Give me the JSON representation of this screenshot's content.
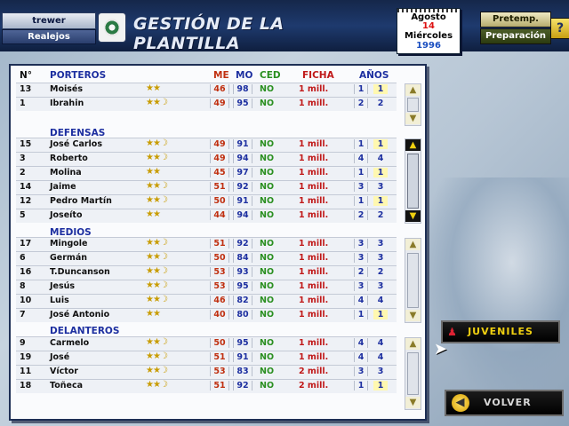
{
  "header": {
    "username": "trewer",
    "club": "Realejos",
    "crest_icon": "club-crest-icon",
    "title": "GESTIÓN DE LA PLANTILLA",
    "mode_preseason": "Pretemp.",
    "mode_preparation": "Preparación",
    "help_label": "?"
  },
  "calendar": {
    "month": "Agosto",
    "day": "14",
    "weekday": "Miércoles",
    "year": "1996"
  },
  "columns": {
    "num": "N°",
    "me": "ME",
    "mo": "MO",
    "ced": "CED",
    "ficha": "FICHA",
    "anos": "AÑOS"
  },
  "sections": {
    "porteros": {
      "label": "PORTEROS",
      "players": [
        {
          "num": "13",
          "name": "Moisés",
          "stars": "★★",
          "me": "46",
          "mo": "98",
          "ced": "NO",
          "ficha": "1 mill.",
          "a1": "1",
          "a2": "1",
          "hl": true
        },
        {
          "num": "1",
          "name": "Ibrahin",
          "stars": "★★☽",
          "me": "49",
          "mo": "95",
          "ced": "NO",
          "ficha": "1 mill.",
          "a1": "2",
          "a2": "2",
          "hl": false
        }
      ]
    },
    "defensas": {
      "label": "DEFENSAS",
      "players": [
        {
          "num": "15",
          "name": "José Carlos",
          "stars": "★★☽",
          "me": "49",
          "mo": "91",
          "ced": "NO",
          "ficha": "1 mill.",
          "a1": "1",
          "a2": "1",
          "hl": true
        },
        {
          "num": "3",
          "name": "Roberto",
          "stars": "★★☽",
          "me": "49",
          "mo": "94",
          "ced": "NO",
          "ficha": "1 mill.",
          "a1": "4",
          "a2": "4",
          "hl": false
        },
        {
          "num": "2",
          "name": "Molina",
          "stars": "★★",
          "me": "45",
          "mo": "97",
          "ced": "NO",
          "ficha": "1 mill.",
          "a1": "1",
          "a2": "1",
          "hl": true
        },
        {
          "num": "14",
          "name": "Jaime",
          "stars": "★★☽",
          "me": "51",
          "mo": "92",
          "ced": "NO",
          "ficha": "1 mill.",
          "a1": "3",
          "a2": "3",
          "hl": false
        },
        {
          "num": "12",
          "name": "Pedro Martín",
          "stars": "★★☽",
          "me": "50",
          "mo": "91",
          "ced": "NO",
          "ficha": "1 mill.",
          "a1": "1",
          "a2": "1",
          "hl": true
        },
        {
          "num": "5",
          "name": "Joseíto",
          "stars": "★★",
          "me": "44",
          "mo": "94",
          "ced": "NO",
          "ficha": "1 mill.",
          "a1": "2",
          "a2": "2",
          "hl": false
        }
      ]
    },
    "medios": {
      "label": "MEDIOS",
      "players": [
        {
          "num": "17",
          "name": "Mingole",
          "stars": "★★☽",
          "me": "51",
          "mo": "92",
          "ced": "NO",
          "ficha": "1 mill.",
          "a1": "3",
          "a2": "3",
          "hl": false
        },
        {
          "num": "6",
          "name": "Germán",
          "stars": "★★☽",
          "me": "50",
          "mo": "84",
          "ced": "NO",
          "ficha": "1 mill.",
          "a1": "3",
          "a2": "3",
          "hl": false
        },
        {
          "num": "16",
          "name": "T.Duncanson",
          "stars": "★★☽",
          "me": "53",
          "mo": "93",
          "ced": "NO",
          "ficha": "1 mill.",
          "a1": "2",
          "a2": "2",
          "hl": false
        },
        {
          "num": "8",
          "name": "Jesús",
          "stars": "★★☽",
          "me": "53",
          "mo": "95",
          "ced": "NO",
          "ficha": "1 mill.",
          "a1": "3",
          "a2": "3",
          "hl": false
        },
        {
          "num": "10",
          "name": "Luis",
          "stars": "★★☽",
          "me": "46",
          "mo": "82",
          "ced": "NO",
          "ficha": "1 mill.",
          "a1": "4",
          "a2": "4",
          "hl": false
        },
        {
          "num": "7",
          "name": "José Antonio",
          "stars": "★★",
          "me": "40",
          "mo": "80",
          "ced": "NO",
          "ficha": "1 mill.",
          "a1": "1",
          "a2": "1",
          "hl": true
        }
      ]
    },
    "delanteros": {
      "label": "DELANTEROS",
      "players": [
        {
          "num": "9",
          "name": "Carmelo",
          "stars": "★★☽",
          "me": "50",
          "mo": "95",
          "ced": "NO",
          "ficha": "1 mill.",
          "a1": "4",
          "a2": "4",
          "hl": false
        },
        {
          "num": "19",
          "name": "José",
          "stars": "★★☽",
          "me": "51",
          "mo": "91",
          "ced": "NO",
          "ficha": "1 mill.",
          "a1": "4",
          "a2": "4",
          "hl": false
        },
        {
          "num": "11",
          "name": "Víctor",
          "stars": "★★☽",
          "me": "53",
          "mo": "83",
          "ced": "NO",
          "ficha": "2 mill.",
          "a1": "3",
          "a2": "3",
          "hl": false
        },
        {
          "num": "18",
          "name": "Toñeca",
          "stars": "★★☽",
          "me": "51",
          "mo": "92",
          "ced": "NO",
          "ficha": "2 mill.",
          "a1": "1",
          "a2": "1",
          "hl": true
        }
      ]
    }
  },
  "buttons": {
    "juveniles": "JUVENILES",
    "volver": "VOLVER"
  },
  "scroll_icons": {
    "up": "▲",
    "down": "▼"
  }
}
